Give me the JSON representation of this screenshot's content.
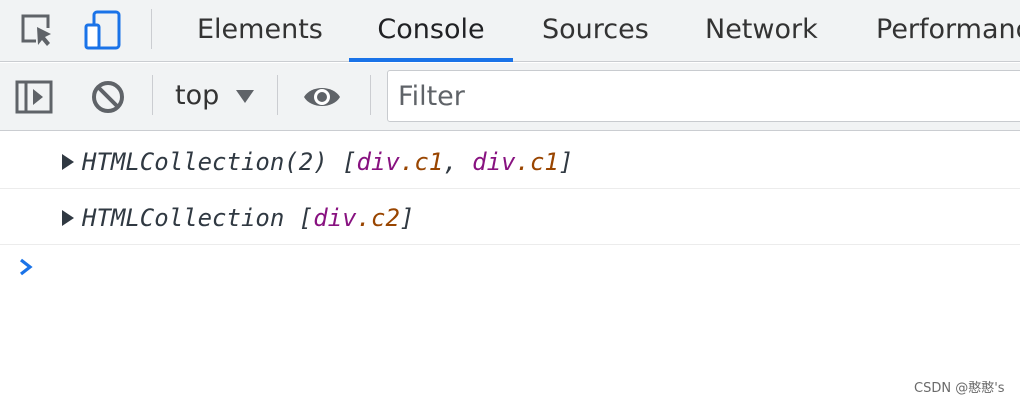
{
  "tabs": {
    "elements": "Elements",
    "console": "Console",
    "sources": "Sources",
    "network": "Network",
    "performance": "Performanc"
  },
  "active_tab": "Console",
  "toolbar": {
    "context": "top",
    "filter_placeholder": "Filter"
  },
  "icons": {
    "inspect": "inspect-element-icon",
    "device": "device-toolbar-icon",
    "sidebar": "console-sidebar-icon",
    "clear": "clear-console-icon",
    "caret": "dropdown-caret-icon",
    "live_expression": "eye-icon",
    "expand": "expand-triangle-icon",
    "prompt": "prompt-chevron-icon"
  },
  "console": {
    "messages": [
      {
        "prefix": "HTMLCollection(2) [",
        "items": [
          {
            "tag": "div",
            "cls": ".c1"
          },
          {
            "tag": "div",
            "cls": ".c1"
          }
        ],
        "separator": ", ",
        "suffix": "]"
      },
      {
        "prefix": "HTMLCollection [",
        "items": [
          {
            "tag": "div",
            "cls": ".c2"
          }
        ],
        "suffix": "]"
      }
    ]
  },
  "colors": {
    "accent": "#1a73e8",
    "element_tag": "#881280",
    "class_name": "#994500",
    "text": "#303942",
    "toolbar_bg": "#f1f3f4"
  },
  "watermark": "CSDN @憨憨's"
}
